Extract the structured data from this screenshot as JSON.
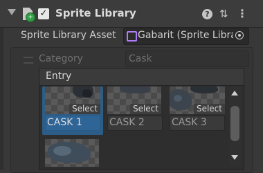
{
  "header": {
    "title": "Sprite Library",
    "collapse_icon": "chevron-down-icon",
    "component_icon": "sprite-library-component-icon",
    "enabled": true,
    "enabled_glyph": "✓",
    "badge_glyph": "+",
    "help_icon": "help-icon",
    "help_glyph": "?",
    "preset_icon": "preset-icon",
    "preset_glyph": "⇅",
    "menu_icon": "kebab-menu-icon",
    "menu_glyph": "⋮"
  },
  "asset_field": {
    "label": "Sprite Library Asset",
    "value": "Gabarit (Sprite Library Asset)",
    "icon": "sprite-library-asset-icon",
    "picker_icon": "object-picker-icon"
  },
  "category": {
    "label": "Category",
    "value": "Cask"
  },
  "entry": {
    "label": "Entry",
    "items": [
      {
        "name": "CASK 1",
        "action": "Select",
        "selected": true
      },
      {
        "name": "CASK 2",
        "action": "Select",
        "selected": false
      },
      {
        "name": "CASK 3",
        "action": "Select",
        "selected": false
      }
    ]
  },
  "colors": {
    "background": "#383838",
    "selection": "#2c5d87",
    "asset_icon": "#b07cff",
    "component_badge": "#2f9e44"
  }
}
